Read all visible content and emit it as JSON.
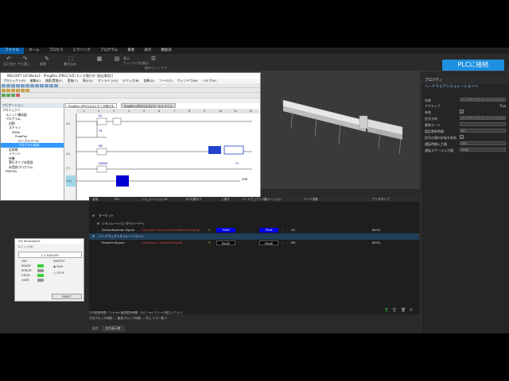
{
  "ribbon": {
    "tabs": [
      "ファイル",
      "ホーム",
      "プロセス",
      "ミラリング",
      "プログラム",
      "重要",
      "表示",
      "機能表"
    ],
    "active_tab": 0,
    "buttons": {
      "btn1": "元に戻す",
      "btn2": "やり直し",
      "btn3": "削除",
      "btn4": "書き込み",
      "show": "表示",
      "window_display": "ウィンドウの表示",
      "window_group": "他のウィンドウ"
    },
    "connect_label": "PLCに接続"
  },
  "properties": {
    "header": "プロパティ",
    "subheader": "ハードウェアシミュレーションへ",
    "rows": [
      {
        "label": "名称",
        "value": "ハードウェアシミュレーションへ",
        "kind": "text"
      },
      {
        "label": "アクティブ",
        "value": "True",
        "kind": "text"
      },
      {
        "label": "有効",
        "value": "✓",
        "kind": "check"
      },
      {
        "label": "信号方向",
        "value": "ハードウェアシミュレーションへ",
        "kind": "text"
      },
      {
        "label": "更新モード",
        "value": "",
        "kind": "text"
      },
      {
        "label": "固定更新時間",
        "value": "50",
        "kind": "text"
      },
      {
        "label": "信号の値の反転を有効",
        "value": "✓",
        "kind": "check"
      },
      {
        "label": "遅延時間入力値",
        "value": "100",
        "kind": "text"
      },
      {
        "label": "遅延スケール入力値",
        "value": "5000",
        "kind": "text"
      }
    ]
  },
  "gx": {
    "title": "MELSOFT GX Works3 - [ProgPou [PRG] [LD] モニタ実行中 (読出専用)]",
    "menu": [
      "プロジェクト(P)",
      "編集(E)",
      "検索/置換(F)",
      "変換(C)",
      "表示(V)",
      "オンライン(O)",
      "デバッグ(B)",
      "診断(D)",
      "ツール(T)",
      "ウィンドウ(W)",
      "ヘルプ(H)"
    ],
    "nav_header": "ナビゲーション",
    "nav_items": [
      {
        "label": "プロジェクト",
        "indent": 0,
        "sel": false
      },
      {
        "label": "ユニット構成図",
        "indent": 1,
        "sel": false
      },
      {
        "label": "プログラム",
        "indent": 1,
        "sel": false
      },
      {
        "label": "初期",
        "indent": 2,
        "sel": false
      },
      {
        "label": "スキャン",
        "indent": 2,
        "sel": false
      },
      {
        "label": "MAIN",
        "indent": 3,
        "sel": false
      },
      {
        "label": "ProgPou",
        "indent": 4,
        "sel": false
      },
      {
        "label": "ローカルラベル",
        "indent": 5,
        "sel": false
      },
      {
        "label": "プログラム本体",
        "indent": 5,
        "sel": true
      },
      {
        "label": "定周期",
        "indent": 2,
        "sel": false
      },
      {
        "label": "イベント",
        "indent": 2,
        "sel": false
      },
      {
        "label": "待機",
        "indent": 2,
        "sel": false
      },
      {
        "label": "実行タイプ未登録",
        "indent": 2,
        "sel": false
      },
      {
        "label": "未登録プログラム",
        "indent": 2,
        "sel": false
      },
      {
        "label": "FB/FUN",
        "indent": 1,
        "sel": false
      }
    ],
    "ladder_tabs": [
      "ProgPou [PRG] [LD] モニタ実行中",
      "ProgPou [PRG] [LD] ローカルラベル"
    ],
    "ladder_cols": [
      "1",
      "2",
      "3",
      "4",
      "5",
      "6",
      "7",
      "8",
      "9",
      "10",
      "11",
      "12"
    ],
    "ladder_rows": [
      "(0)",
      "(3)",
      "(7)",
      "(11)"
    ],
    "contacts": [
      "X0",
      "Y0",
      "M0",
      "SM400",
      "Y1"
    ],
    "end_label": "END"
  },
  "io": {
    "headers": [
      "名前",
      "PLC",
      "シミュレーションIO",
      "IO 付属タブ",
      "上書き",
      "ハードウェアシミュレーション",
      "値",
      "ハード変数",
      "データタイプ"
    ],
    "group1": "ターゲット",
    "group2": "ハードウェアシミュレーションへ",
    "sub1": "シミュレーションからハードへ",
    "rows": [
      {
        "name": "SensorBoolean.Signal",
        "plc": "Conveyor Sensor.SensorBooleanSignal",
        "value": "TRUE",
        "value2": "TRUE",
        "var": "X0",
        "type": "BOOL",
        "row": "sensor"
      },
      {
        "name": "PowerOnSignal",
        "plc": "Conveyor 1.PowerOnSignal",
        "value": "FALSE",
        "value2": "FALSE",
        "var": "M0",
        "type": "BOOL",
        "row": "power"
      }
    ]
  },
  "sim": {
    "title": "GX Simulator3",
    "subtitle": "ユニット(U)",
    "unit": "1.1 R00CPU",
    "led_label": "LED",
    "switch_label": "SWITCH",
    "leds": [
      "READY",
      "ERROR",
      "P.RUN",
      "USER"
    ],
    "run": "RUN",
    "stop": "STOP",
    "reset": "RESET"
  },
  "status": {
    "line1": "平均更新時間:   71.6 ms     最長更新時間:   120.7 ms   エラーの発生ペアル   0",
    "line2": "平均ブロック時間:   ...     最長ブロック時間:   ...        同上 エラー数   0"
  },
  "bottom_tabs": [
    "出力",
    "信号表示数"
  ],
  "colors": {
    "accent": "#1e90e0",
    "true_blue": "#0000e6",
    "false_black": "#000000",
    "check_green": "#2ecc40"
  }
}
